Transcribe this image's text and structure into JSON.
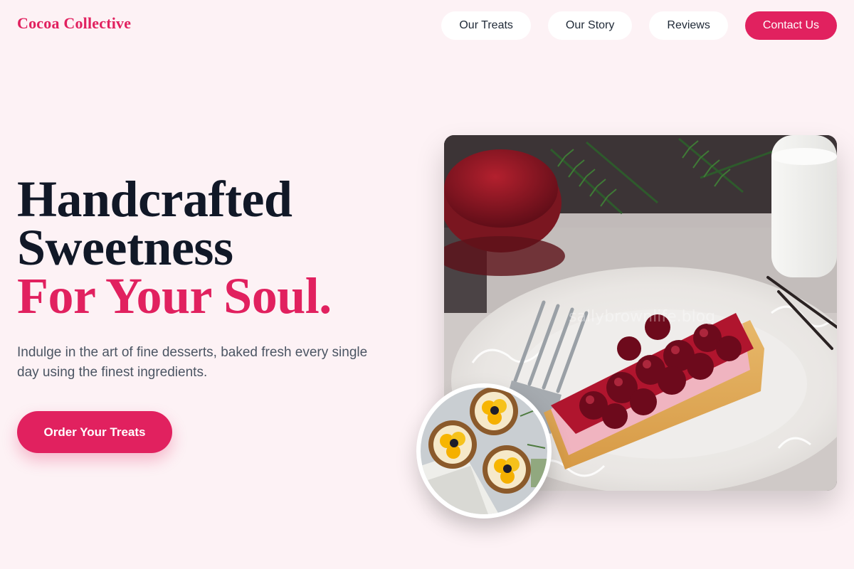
{
  "header": {
    "brand": "Cocoa Collective",
    "nav": [
      {
        "label": "Our Treats"
      },
      {
        "label": "Our Story"
      },
      {
        "label": "Reviews"
      },
      {
        "label": "Contact Us"
      }
    ]
  },
  "hero": {
    "title_line1": "Handcrafted",
    "title_line2": "Sweetness",
    "title_accent": "For Your Soul.",
    "subtitle": "Indulge in the art of fine desserts, baked fresh every single day using the finest ingredients.",
    "cta_label": "Order Your Treats",
    "image_watermark": "sallybrownlife.blog"
  },
  "colors": {
    "accent": "#e1215f",
    "background": "#fdf2f5",
    "heading": "#111827",
    "body_text": "#4b5563"
  }
}
